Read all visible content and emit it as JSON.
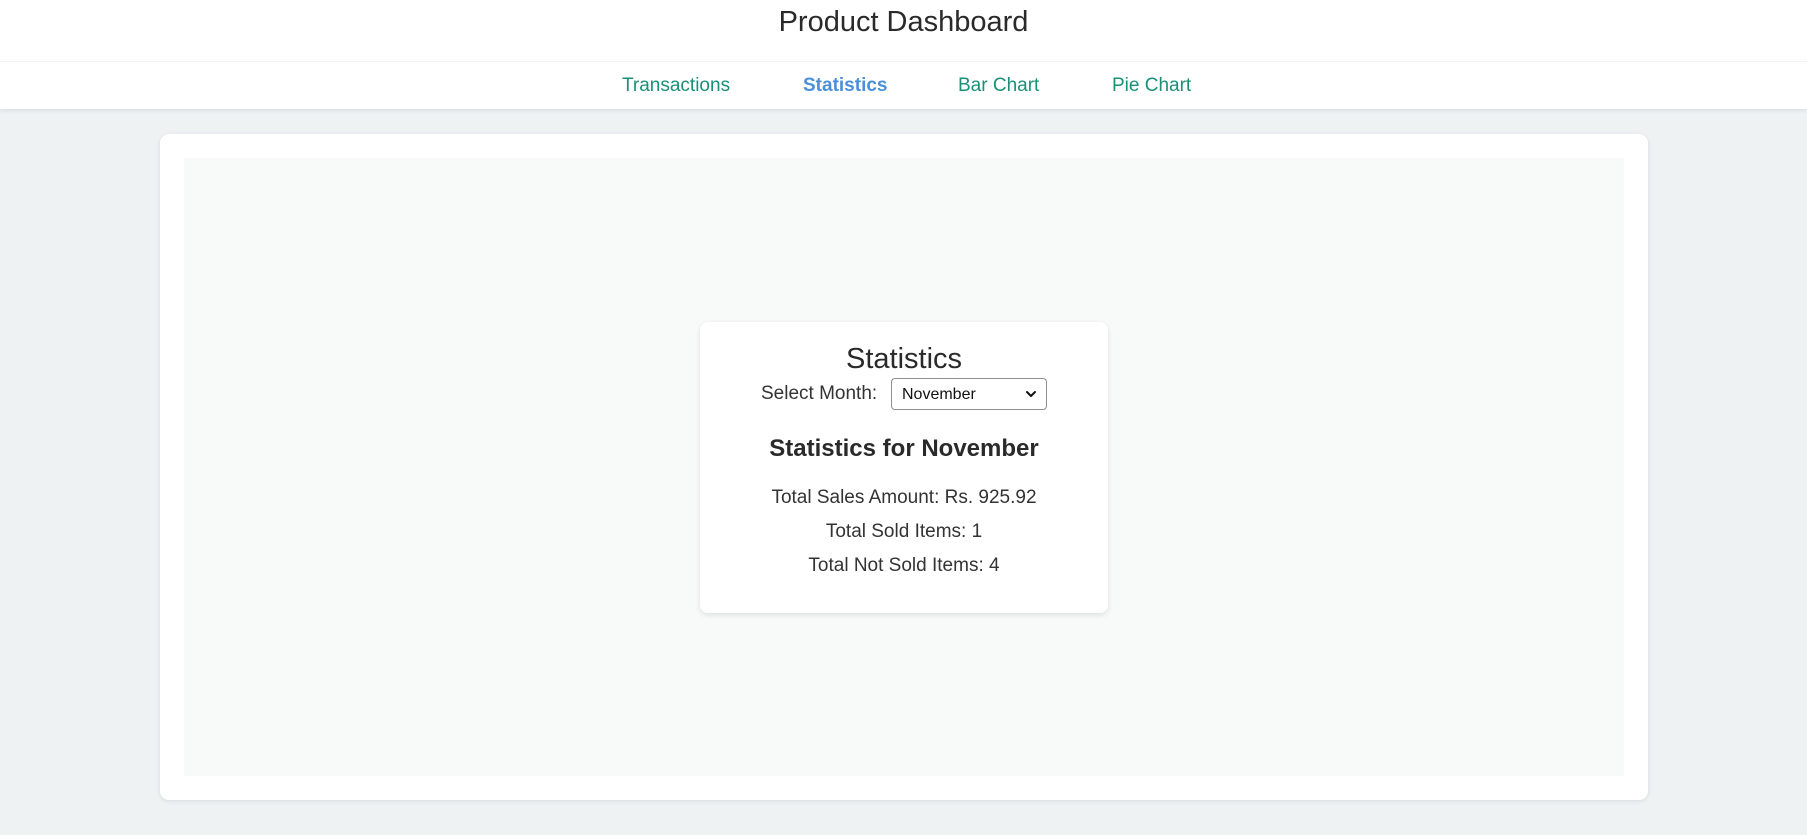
{
  "header": {
    "title": "Product Dashboard"
  },
  "nav": {
    "items": [
      {
        "label": "Transactions",
        "active": false
      },
      {
        "label": "Statistics",
        "active": true
      },
      {
        "label": "Bar Chart",
        "active": false
      },
      {
        "label": "Pie Chart",
        "active": false
      }
    ]
  },
  "statistics": {
    "heading": "Statistics",
    "month_label": "Select Month:",
    "selected_month": "November",
    "subheading": "Statistics for November",
    "total_sales": "Total Sales Amount: Rs. 925.92",
    "total_sold": "Total Sold Items: 1",
    "total_not_sold": "Total Not Sold Items: 4"
  },
  "colors": {
    "nav_link": "#1a9077",
    "nav_active": "#4a90d9",
    "background": "#eef2f3"
  },
  "icons": {
    "select_caret": "chevron-down-icon"
  }
}
